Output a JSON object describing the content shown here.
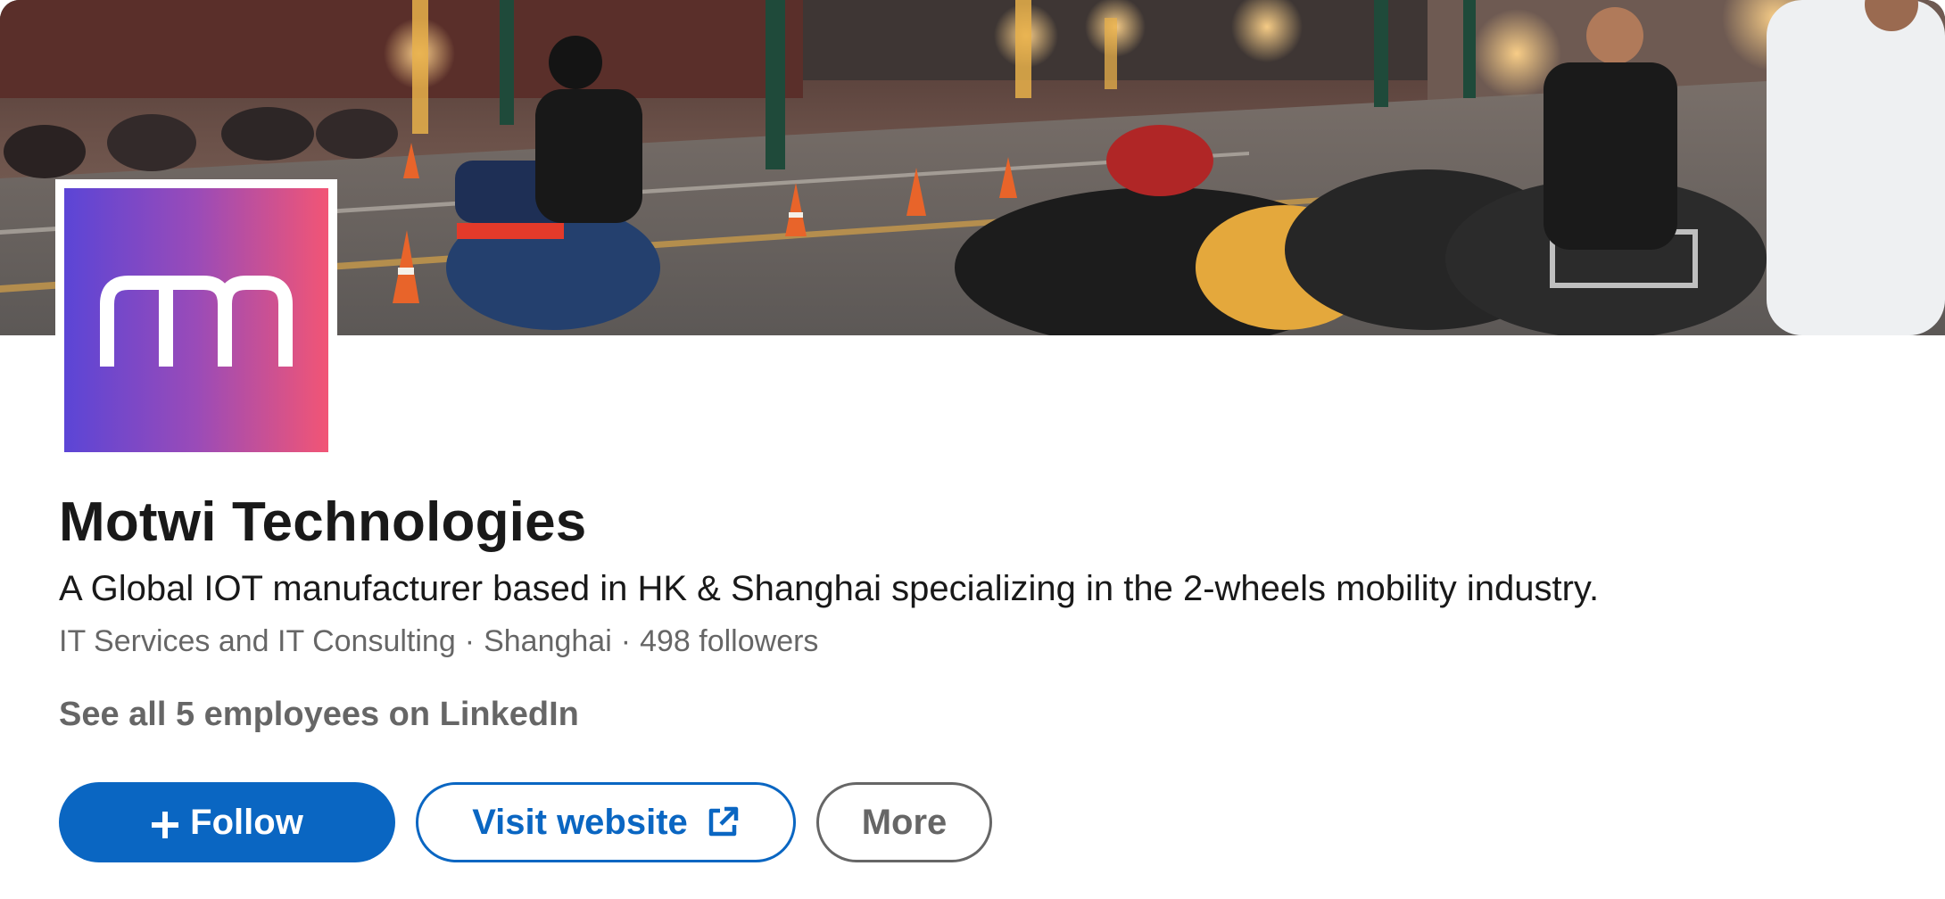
{
  "company": {
    "name": "Motwi Technologies",
    "tagline": "A Global IOT manufacturer based in HK & Shanghai specializing in the 2-wheels mobility industry.",
    "industry": "IT Services and IT Consulting",
    "location": "Shanghai",
    "followers": "498 followers",
    "separator": "·",
    "employees_link": "See all 5 employees on LinkedIn",
    "logo_icon": "m-logo-icon"
  },
  "cover": {
    "icon": "cover-photo-motorcycles"
  },
  "actions": {
    "follow_label": "Follow",
    "follow_icon": "plus-icon",
    "visit_label": "Visit website",
    "visit_icon": "external-link-icon",
    "more_label": "More"
  },
  "colors": {
    "primary": "#0a66c2",
    "logo_gradient_start": "#5b45d6",
    "logo_gradient_end": "#f25575",
    "muted_text": "#666666"
  }
}
